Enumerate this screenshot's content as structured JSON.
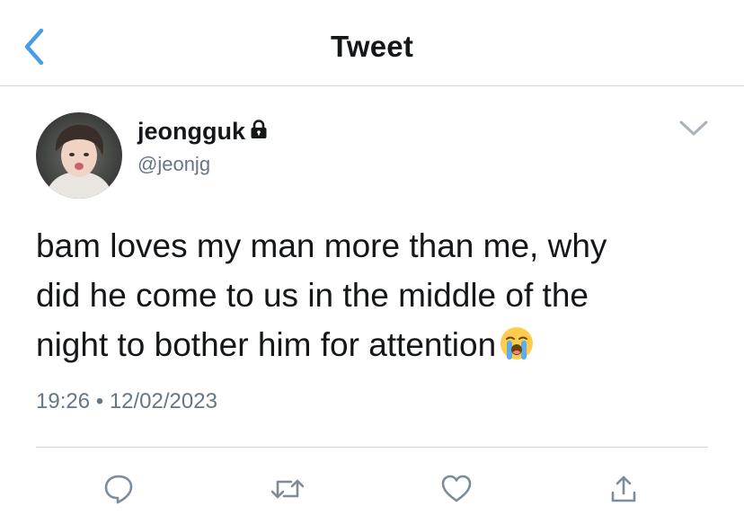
{
  "header": {
    "title": "Tweet",
    "back_icon": "chevron-left-icon"
  },
  "tweet": {
    "display_name": "jeongguk",
    "protected_icon": "lock-icon",
    "handle": "@jeonjg",
    "text_lines": [
      "bam loves my man more than me, why",
      "did he come to us in the middle of the",
      "night to bother him for attention"
    ],
    "emoji": "loudly-crying-face-icon",
    "time": "19:26",
    "separator": "•",
    "date": "12/02/2023"
  },
  "actions": [
    "reply-icon",
    "retweet-icon",
    "like-icon",
    "share-icon"
  ],
  "colors": {
    "accent": "#4a9ce8",
    "secondary_text": "#657786",
    "divider": "#cfd4d9",
    "action_icon": "#7d8c99"
  }
}
